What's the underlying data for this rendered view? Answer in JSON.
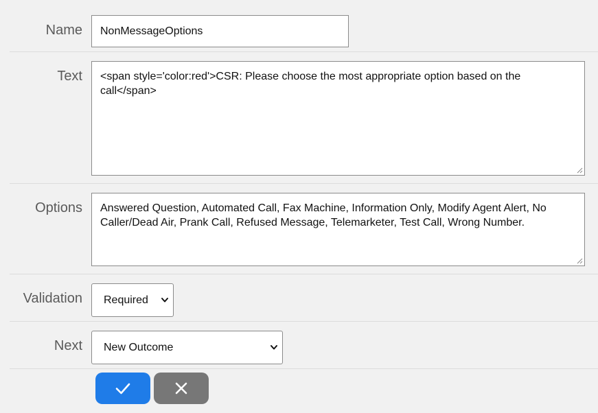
{
  "form": {
    "name": {
      "label": "Name",
      "value": "NonMessageOptions"
    },
    "text": {
      "label": "Text",
      "value": "<span style='color:red'>CSR: Please choose the most appropriate option based on the call</span>"
    },
    "options": {
      "label": "Options",
      "value": "Answered Question, Automated Call, Fax Machine, Information Only, Modify Agent Alert, No Caller/Dead Air, Prank Call, Refused Message, Telemarketer, Test Call, Wrong Number."
    },
    "validation": {
      "label": "Validation",
      "selected": "Required"
    },
    "next": {
      "label": "Next",
      "selected": "New Outcome"
    }
  },
  "actions": {
    "confirm_icon": "check-icon",
    "cancel_icon": "close-icon"
  },
  "colors": {
    "background": "#f1f1f1",
    "confirm": "#1f7ce8",
    "cancel": "#777777"
  }
}
